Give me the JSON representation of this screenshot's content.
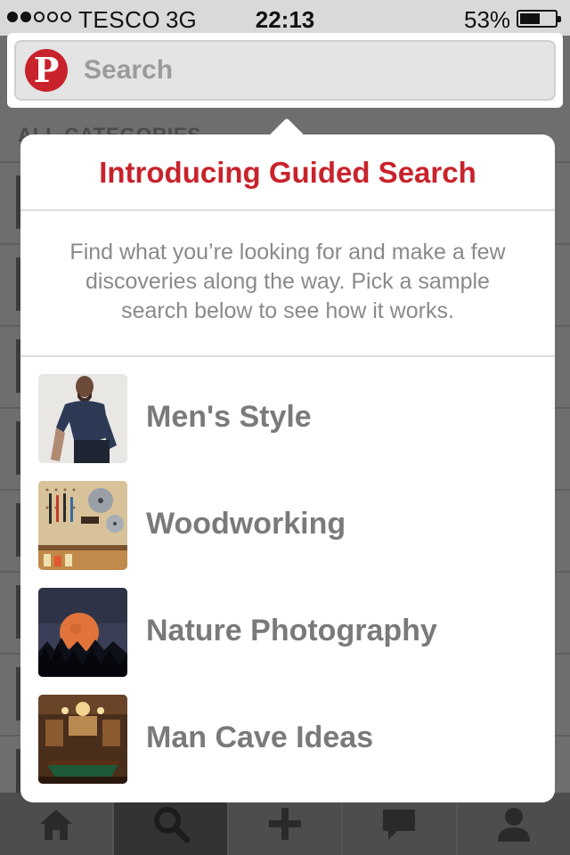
{
  "status_bar": {
    "signal_dots_on": 2,
    "signal_dots_total": 5,
    "carrier": "TESCO",
    "network": "3G",
    "time": "22:13",
    "battery_percent": "53%",
    "battery_level": 0.53
  },
  "search": {
    "placeholder": "Search",
    "logo_glyph": "P",
    "logo_icon": "pinterest-logo-icon"
  },
  "background": {
    "header": "ALL CATEGORIES"
  },
  "popover": {
    "title": "Introducing Guided Search",
    "description": "Find what you’re looking for and make a few discoveries along the way. Pick a sample search below to see how it works.",
    "samples": [
      {
        "label": "Men's Style",
        "thumb": "mens-style-photo"
      },
      {
        "label": "Woodworking",
        "thumb": "woodworking-photo"
      },
      {
        "label": "Nature Photography",
        "thumb": "nature-photo"
      },
      {
        "label": "Man Cave Ideas",
        "thumb": "man-cave-photo"
      }
    ]
  },
  "tab_bar": {
    "tabs": [
      {
        "icon": "home-icon"
      },
      {
        "icon": "search-icon",
        "active": true
      },
      {
        "icon": "plus-icon"
      },
      {
        "icon": "notifications-icon"
      },
      {
        "icon": "profile-icon"
      }
    ]
  },
  "colors": {
    "accent": "#c8232c",
    "label_gray": "#7a7a7a",
    "description_gray": "#8a8a8a",
    "overlay_gray": "#6e6e6e"
  }
}
